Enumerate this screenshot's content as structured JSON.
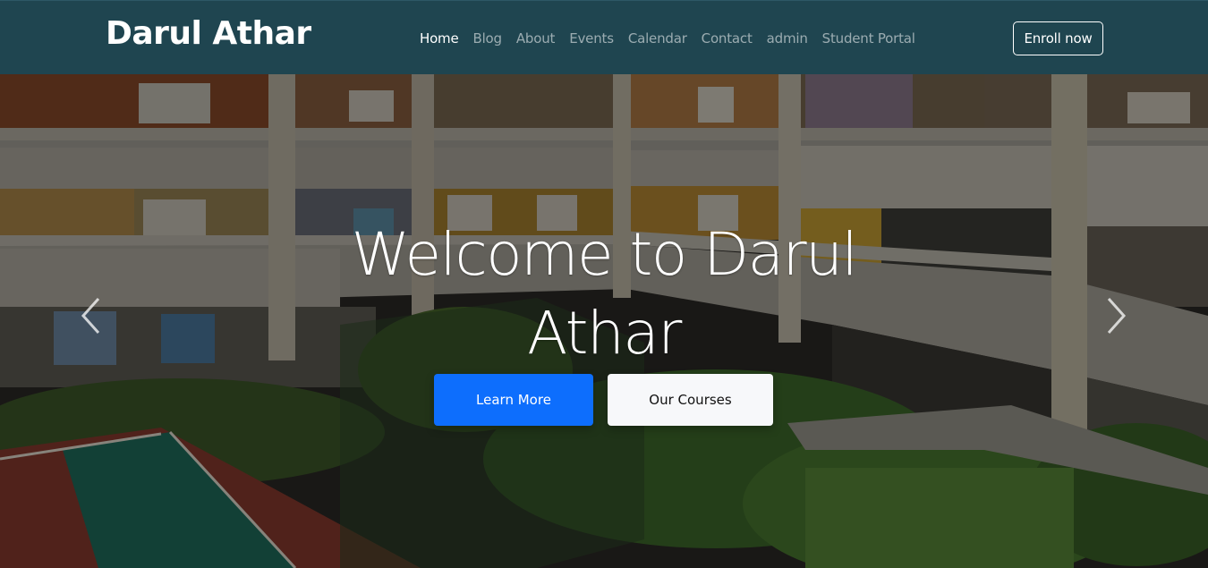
{
  "navbar": {
    "brand": "Darul Athar",
    "links": [
      {
        "label": "Home",
        "active": true
      },
      {
        "label": "Blog"
      },
      {
        "label": "About"
      },
      {
        "label": "Events"
      },
      {
        "label": "Calendar"
      },
      {
        "label": "Contact"
      },
      {
        "label": "admin"
      },
      {
        "label": "Student Portal"
      }
    ],
    "enroll_label": "Enroll now"
  },
  "hero": {
    "title": "Welcome to Darul Athar",
    "primary_button": "Learn More",
    "secondary_button": "Our Courses",
    "prev_icon": "chevron-left-icon",
    "next_icon": "chevron-right-icon"
  },
  "colors": {
    "navbar_bg": "#1f4550",
    "primary": "#0d6efd",
    "light": "#f7f8fa"
  }
}
